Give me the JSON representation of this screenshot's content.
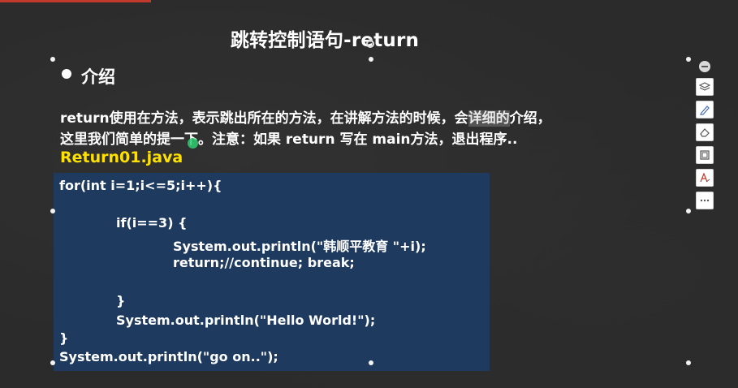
{
  "slide": {
    "title": "跳转控制语句-return",
    "bullet": "介绍",
    "desc_part1": "return使用在方法，表示跳出所在的方法，在讲解方法的时候，会",
    "desc_highlight": "详细的",
    "desc_part2": "介绍，",
    "desc_line2": "这里我们简单的提一下。注意：如果 return 写在 main方法，退出程序..",
    "filename": "Return01.java"
  },
  "code": {
    "lines": [
      "for(int i=1;i<=5;i++){",
      "if(i==3) {",
      "System.out.println(\"韩顺平教育 \"+i);",
      "return;//continue; break;",
      "}",
      "System.out.println(\"Hello World!\");",
      "}",
      "System.out.println(\"go on..\");"
    ]
  },
  "toolbar": {
    "icons": [
      "collapse-icon",
      "layers-icon",
      "pen-icon",
      "eraser-icon",
      "frame-icon",
      "text-style-icon",
      "more-icon"
    ]
  },
  "colors": {
    "background": "#2b2b2b",
    "code_bg": "#1e3a5f",
    "filename": "#ffe100",
    "highlight": "#555555"
  }
}
